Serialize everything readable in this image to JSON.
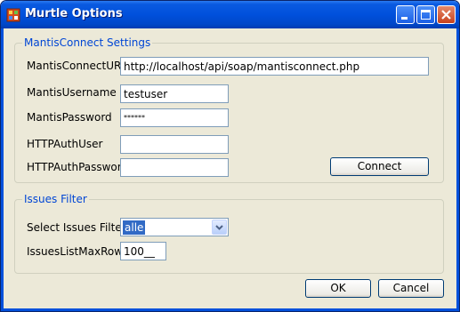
{
  "window": {
    "title": "Murtle Options"
  },
  "mantis_group": {
    "title": "MantisConnect Settings",
    "url_label": "MantisConnectURL",
    "url_value": "http://localhost/api/soap/mantisconnect.php",
    "username_label": "MantisUsername",
    "username_value": "testuser",
    "password_label": "MantisPassword",
    "password_value": "******",
    "http_user_label": "HTTPAuthUser",
    "http_user_value": "",
    "http_password_label": "HTTPAuthPassword",
    "http_password_value": "",
    "connect_label": "Connect"
  },
  "issues_group": {
    "title": "Issues Filter",
    "filter_label": "Select Issues Filter",
    "filter_value": "alle",
    "maxrows_label": "IssuesListMaxRows",
    "maxrows_value": "100__"
  },
  "footer": {
    "ok_label": "OK",
    "cancel_label": "Cancel"
  }
}
